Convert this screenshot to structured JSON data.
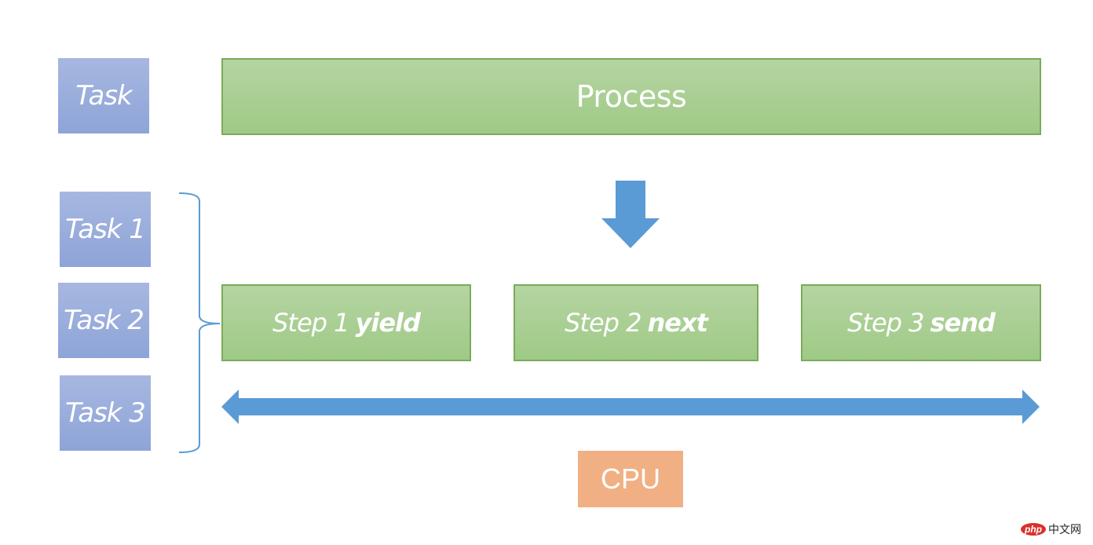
{
  "tasks": {
    "single": "Task",
    "list": [
      "Task 1",
      "Task 2",
      "Task 3"
    ]
  },
  "process": {
    "label": "Process"
  },
  "steps": [
    {
      "prefix": "Step 1",
      "keyword": "yield"
    },
    {
      "prefix": "Step 2",
      "keyword": "next"
    },
    {
      "prefix": "Step 3",
      "keyword": "send"
    }
  ],
  "cpu": {
    "label": "CPU"
  },
  "arrows": {
    "down": "down-arrow",
    "bidirectional": "double-headed-arrow"
  },
  "colors": {
    "task_blue": "#97aadb",
    "process_green": "#a8cf91",
    "green_border": "#7aab59",
    "arrow_blue": "#5b9bd5",
    "cpu_orange": "#f1b083"
  },
  "watermark": {
    "badge": "php",
    "text": "中文网"
  }
}
